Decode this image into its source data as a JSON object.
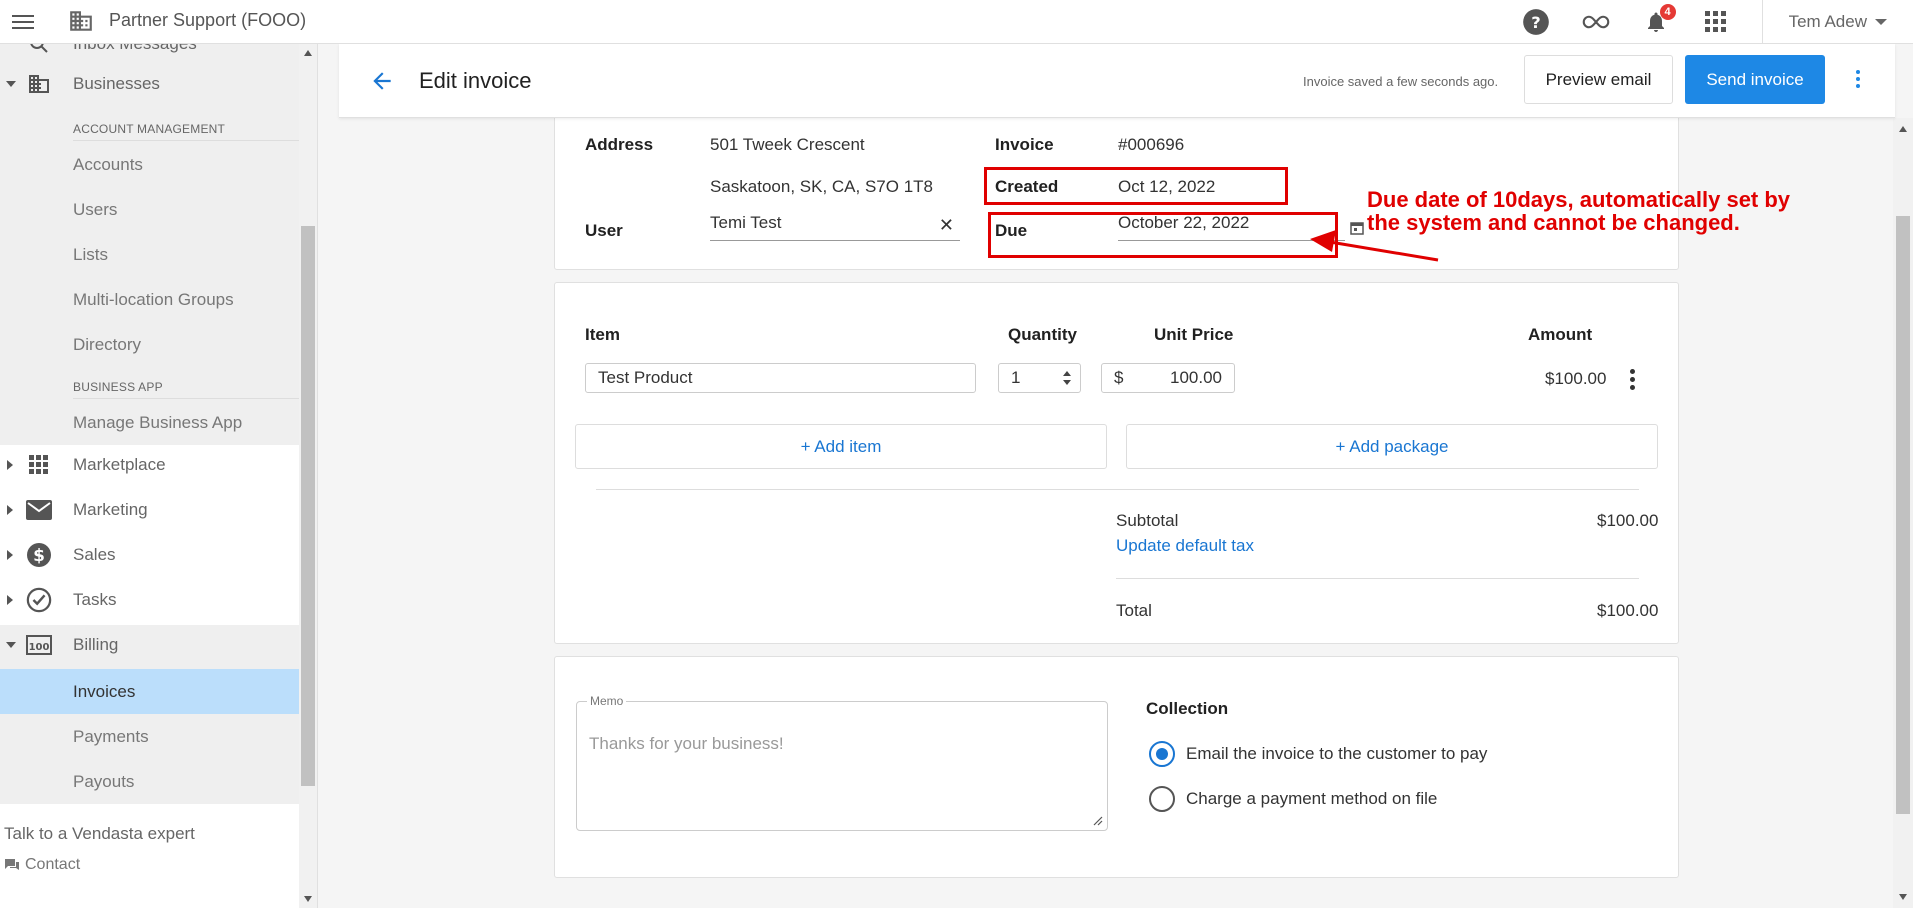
{
  "topbar": {
    "app_title": "Partner Support (FOOO)",
    "notification_count": "4",
    "user_name": "Tem Adew"
  },
  "sidebar": {
    "partial_item": "Inbox Messages",
    "businesses": "Businesses",
    "section_account": "ACCOUNT MANAGEMENT",
    "accounts": "Accounts",
    "users": "Users",
    "lists": "Lists",
    "multi_location": "Multi-location Groups",
    "directory": "Directory",
    "section_business_app": "BUSINESS APP",
    "manage_business_app": "Manage Business App",
    "marketplace": "Marketplace",
    "marketing": "Marketing",
    "sales": "Sales",
    "tasks": "Tasks",
    "billing": "Billing",
    "invoices": "Invoices",
    "payments": "Payments",
    "payouts": "Payouts",
    "talk_expert": "Talk to a Vendasta expert",
    "contact": "Contact"
  },
  "header": {
    "title": "Edit invoice",
    "saved_status": "Invoice saved a few seconds ago.",
    "preview_label": "Preview email",
    "send_label": "Send invoice"
  },
  "details": {
    "address_label": "Address",
    "address_line1": "501 Tweek Crescent",
    "address_line2": "Saskatoon, SK, CA, S7O 1T8",
    "user_label": "User",
    "user_value": "Temi Test",
    "invoice_label": "Invoice",
    "invoice_value": "#000696",
    "created_label": "Created",
    "created_value": "Oct 12, 2022",
    "due_label": "Due",
    "due_value": "October 22, 2022"
  },
  "annotation": {
    "line1": "Due date of 10days, automatically set by",
    "line2": "the system and cannot be changed."
  },
  "items": {
    "col_item": "Item",
    "col_quantity": "Quantity",
    "col_unit_price": "Unit Price",
    "col_amount": "Amount",
    "rows": [
      {
        "item": "Test Product",
        "quantity": "1",
        "currency": "$",
        "unit_price": "100.00",
        "amount": "$100.00"
      }
    ],
    "add_item": "+ Add item",
    "add_package": "+ Add package",
    "subtotal_label": "Subtotal",
    "subtotal_value": "$100.00",
    "update_tax": "Update default tax",
    "total_label": "Total",
    "total_value": "$100.00"
  },
  "footer": {
    "memo_label": "Memo",
    "memo_placeholder": "Thanks for your business!",
    "collection_title": "Collection",
    "option_email": "Email the invoice to the customer to pay",
    "option_charge": "Charge a payment method on file"
  },
  "colors": {
    "accent": "#1e88e5",
    "active_nav": "#bbdefb",
    "annotation_red": "#e00000",
    "badge_red": "#e53935"
  }
}
